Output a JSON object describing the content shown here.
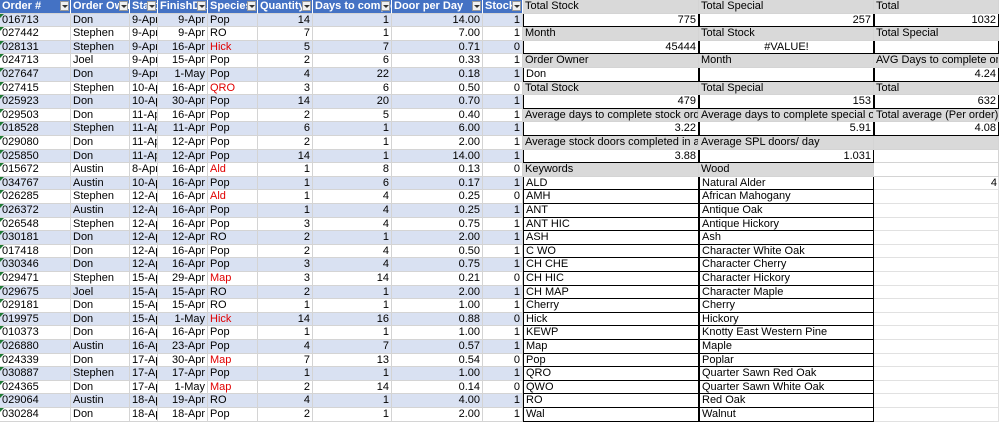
{
  "table": {
    "headers": [
      "Order #",
      "Order Owner",
      "StartD",
      "FinishDa",
      "Species",
      "Quantity",
      "Days to complete",
      "Door per Day",
      "Stock"
    ],
    "rows": [
      [
        "016713",
        "Don",
        "9-Apr",
        "9-Apr",
        "Pop",
        "14",
        "1",
        "14.00",
        "1"
      ],
      [
        "027442",
        "Stephen",
        "9-Apr",
        "9-Apr",
        "RO",
        "7",
        "1",
        "7.00",
        "1"
      ],
      [
        "028131",
        "Stephen",
        "9-Apr",
        "16-Apr",
        "Hick",
        "5",
        "7",
        "0.71",
        "0"
      ],
      [
        "024713",
        "Joel",
        "9-Apr",
        "15-Apr",
        "Pop",
        "2",
        "6",
        "0.33",
        "1"
      ],
      [
        "027647",
        "Don",
        "9-Apr",
        "1-May",
        "Pop",
        "4",
        "22",
        "0.18",
        "1"
      ],
      [
        "027415",
        "Stephen",
        "10-Apr",
        "16-Apr",
        "QRO",
        "3",
        "6",
        "0.50",
        "0"
      ],
      [
        "025923",
        "Don",
        "10-Apr",
        "30-Apr",
        "Pop",
        "14",
        "20",
        "0.70",
        "1"
      ],
      [
        "029503",
        "Don",
        "11-Apr",
        "16-Apr",
        "Pop",
        "2",
        "5",
        "0.40",
        "1"
      ],
      [
        "018528",
        "Stephen",
        "11-Apr",
        "11-Apr",
        "Pop",
        "6",
        "1",
        "6.00",
        "1"
      ],
      [
        "029080",
        "Don",
        "11-Apr",
        "12-Apr",
        "Pop",
        "2",
        "1",
        "2.00",
        "1"
      ],
      [
        "025850",
        "Don",
        "11-Apr",
        "12-Apr",
        "Pop",
        "14",
        "1",
        "14.00",
        "1"
      ],
      [
        "015672",
        "Austin",
        "8-Apr",
        "16-Apr",
        "Ald",
        "1",
        "8",
        "0.13",
        "0"
      ],
      [
        "034767",
        "Austin",
        "10-Apr",
        "16-Apr",
        "Pop",
        "1",
        "6",
        "0.17",
        "1"
      ],
      [
        "026285",
        "Stephen",
        "12-Apr",
        "16-Apr",
        "Ald",
        "1",
        "4",
        "0.25",
        "0"
      ],
      [
        "026372",
        "Austin",
        "12-Apr",
        "16-Apr",
        "Pop",
        "1",
        "4",
        "0.25",
        "1"
      ],
      [
        "026548",
        "Stephen",
        "12-Apr",
        "16-Apr",
        "Pop",
        "3",
        "4",
        "0.75",
        "1"
      ],
      [
        "030181",
        "Don",
        "12-Apr",
        "12-Apr",
        "RO",
        "2",
        "1",
        "2.00",
        "1"
      ],
      [
        "017418",
        "Don",
        "12-Apr",
        "16-Apr",
        "Pop",
        "2",
        "4",
        "0.50",
        "1"
      ],
      [
        "030346",
        "Don",
        "12-Apr",
        "16-Apr",
        "Pop",
        "3",
        "4",
        "0.75",
        "1"
      ],
      [
        "029471",
        "Stephen",
        "15-Apr",
        "29-Apr",
        "Map",
        "3",
        "14",
        "0.21",
        "0"
      ],
      [
        "029675",
        "Joel",
        "15-Apr",
        "15-Apr",
        "RO",
        "2",
        "1",
        "2.00",
        "1"
      ],
      [
        "029181",
        "Don",
        "15-Apr",
        "15-Apr",
        "RO",
        "1",
        "1",
        "1.00",
        "1"
      ],
      [
        "019975",
        "Don",
        "15-Apr",
        "1-May",
        "Hick",
        "14",
        "16",
        "0.88",
        "0"
      ],
      [
        "010373",
        "Don",
        "16-Apr",
        "16-Apr",
        "Pop",
        "1",
        "1",
        "1.00",
        "1"
      ],
      [
        "026880",
        "Austin",
        "16-Apr",
        "23-Apr",
        "Pop",
        "4",
        "7",
        "0.57",
        "1"
      ],
      [
        "024339",
        "Don",
        "17-Apr",
        "30-Apr",
        "Map",
        "7",
        "13",
        "0.54",
        "0"
      ],
      [
        "030887",
        "Stephen",
        "17-Apr",
        "17-Apr",
        "Pop",
        "1",
        "1",
        "1.00",
        "1"
      ],
      [
        "024365",
        "Don",
        "17-Apr",
        "1-May",
        "Map",
        "2",
        "14",
        "0.14",
        "0"
      ],
      [
        "029064",
        "Austin",
        "18-Apr",
        "19-Apr",
        "RO",
        "4",
        "1",
        "4.00",
        "1"
      ],
      [
        "030284",
        "Don",
        "18-Apr",
        "18-Apr",
        "Pop",
        "2",
        "1",
        "2.00",
        "1"
      ]
    ]
  },
  "red_species": [
    "Hick",
    "QRO",
    "Ald",
    "Map"
  ],
  "summary": {
    "total_stock_label": "Total Stock",
    "total_special_label": "Total Special",
    "total_label": "Total",
    "total_stock": "775",
    "total_special": "257",
    "total": "1032",
    "month_label": "Month",
    "total_stock_label2": "Total Stock",
    "total_special_label2": "Total Special",
    "month_value": "45444",
    "value_error": "#VALUE!",
    "order_owner_label": "Order Owner",
    "month_label2": "Month",
    "avg_days_label": "AVG Days to complete order",
    "owner_value": "Don",
    "avg_days_value": "4.24",
    "total_stock_label3": "Total Stock",
    "total_special_label3": "Total Special",
    "total_label3": "Total",
    "owner_stock": "479",
    "owner_special": "153",
    "owner_total": "632",
    "avg_stock_label": "Average days to complete stock order",
    "avg_special_label": "Average days to complete special order",
    "total_avg_label": "Total average (Per order)",
    "avg_stock_value": "3.22",
    "avg_special_value": "5.91",
    "total_avg_value": "4.08",
    "avg_stock_doors_label": "Average stock doors completed in a day",
    "avg_spl_doors_label": "Average SPL doors/ day",
    "avg_stock_doors_value": "3.88",
    "avg_spl_doors_value": "1.031",
    "keywords_label": "Keywords",
    "wood_label": "Wood",
    "stray_value": "4"
  },
  "keywords": [
    [
      "ALD",
      "Natural Alder"
    ],
    [
      "AMH",
      "African Mahogany"
    ],
    [
      "ANT",
      "Antique Oak"
    ],
    [
      "ANT HIC",
      "Antique Hickory"
    ],
    [
      "ASH",
      "Ash"
    ],
    [
      "C WO",
      "Character White Oak"
    ],
    [
      "CH CHE",
      "Character Cherry"
    ],
    [
      "CH HIC",
      "Character Hickory"
    ],
    [
      "CH MAP",
      "Character Maple"
    ],
    [
      "Cherry",
      "Cherry"
    ],
    [
      "Hick",
      "Hickory"
    ],
    [
      "KEWP",
      "Knotty East Western Pine"
    ],
    [
      "Map",
      "Maple"
    ],
    [
      "Pop",
      "Poplar"
    ],
    [
      "QRO",
      "Quarter Sawn Red Oak"
    ],
    [
      "QWO",
      "Quarter Sawn White Oak"
    ],
    [
      "RO",
      "Red Oak"
    ],
    [
      "Wal",
      "Walnut"
    ]
  ]
}
